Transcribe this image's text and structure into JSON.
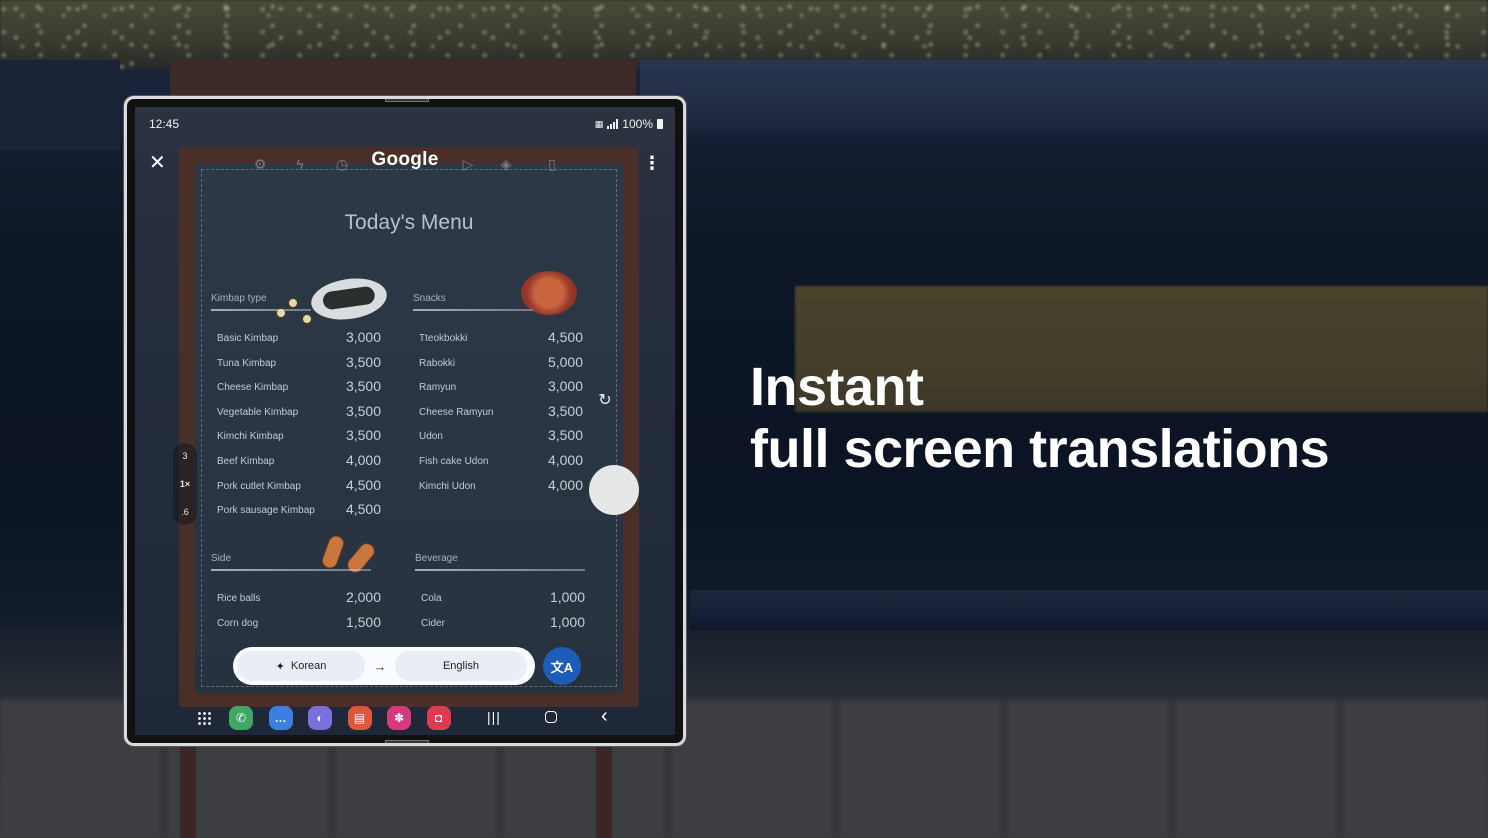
{
  "headline": {
    "line1": "Instant",
    "line2": "full screen translations"
  },
  "status_bar": {
    "time": "12:45",
    "battery": "100%",
    "icons": [
      "data-saver-icon",
      "signal-icon",
      "battery-icon"
    ]
  },
  "lens_toolbar": {
    "close_icon": "✕",
    "logo": "Google",
    "more_icon": "⋮",
    "tools": [
      {
        "name": "settings-icon",
        "glyph": "⚙"
      },
      {
        "name": "flash-icon",
        "glyph": "ϟ"
      },
      {
        "name": "timer-icon",
        "glyph": "◷"
      },
      {
        "name": "video-icon",
        "glyph": "▷"
      },
      {
        "name": "layers-icon",
        "glyph": "◈"
      },
      {
        "name": "panel-icon",
        "glyph": "▯"
      }
    ]
  },
  "menu": {
    "title": "Today's Menu",
    "sections": [
      {
        "label": "Kimbap type",
        "items": [
          {
            "name": "Basic Kimbap",
            "price": "3,000"
          },
          {
            "name": "Tuna Kimbap",
            "price": "3,500"
          },
          {
            "name": "Cheese Kimbap",
            "price": "3,500"
          },
          {
            "name": "Vegetable Kimbap",
            "price": "3,500"
          },
          {
            "name": "Kimchi Kimbap",
            "price": "3,500"
          },
          {
            "name": "Beef Kimbap",
            "price": "4,000"
          },
          {
            "name": "Pork cutlet Kimbap",
            "price": "4,500"
          },
          {
            "name": "Pork sausage Kimbap",
            "price": "4,500"
          }
        ]
      },
      {
        "label": "Snacks",
        "items": [
          {
            "name": "Tteokbokki",
            "price": "4,500"
          },
          {
            "name": "Rabokki",
            "price": "5,000"
          },
          {
            "name": "Ramyun",
            "price": "3,000"
          },
          {
            "name": "Cheese Ramyun",
            "price": "3,500"
          },
          {
            "name": "Udon",
            "price": "3,500"
          },
          {
            "name": "Fish cake Udon",
            "price": "4,000"
          },
          {
            "name": "Kimchi Udon",
            "price": "4,000"
          }
        ]
      },
      {
        "label": "Side",
        "items": [
          {
            "name": "Rice balls",
            "price": "2,000"
          },
          {
            "name": "Corn dog",
            "price": "1,500"
          }
        ]
      },
      {
        "label": "Beverage",
        "items": [
          {
            "name": "Cola",
            "price": "1,000"
          },
          {
            "name": "Cider",
            "price": "1,000"
          }
        ]
      }
    ]
  },
  "zoom_control": {
    "levels": [
      "3",
      "1×",
      ".6"
    ],
    "current": "1×"
  },
  "camera_controls": {
    "refresh_icon": "↻"
  },
  "translate_bar": {
    "source_language": "Korean",
    "source_icon": "✦",
    "arrow": "→",
    "target_language": "English",
    "translate_icon": "文A"
  },
  "nav_bar": {
    "apps": [
      {
        "name": "phone",
        "glyph": "✆",
        "color": "#3fa863"
      },
      {
        "name": "messages",
        "glyph": "…",
        "color": "#3d7fe0"
      },
      {
        "name": "internet",
        "glyph": "◐",
        "color": "#7b6fe0"
      },
      {
        "name": "notes",
        "glyph": "▤",
        "color": "#e0563a"
      },
      {
        "name": "gallery",
        "glyph": "✽",
        "color": "#d63a7c"
      },
      {
        "name": "camera",
        "glyph": "◘",
        "color": "#e03a52"
      }
    ],
    "recents_icon": "|||",
    "back_icon": "‹"
  },
  "colors": {
    "translate_fab": "#1f5bb8",
    "lang_bar": "#fbfcff",
    "lang_chip": "#e9edf6",
    "board": "#2b3745"
  }
}
